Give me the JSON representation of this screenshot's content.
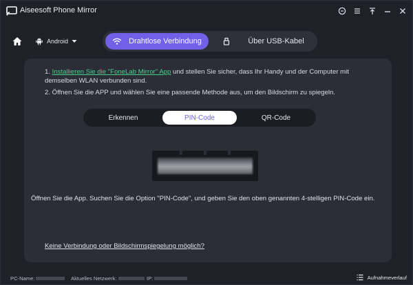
{
  "app": {
    "title": "Aiseesoft Phone Mirror"
  },
  "window_controls": [
    "feedback-icon",
    "menu-icon",
    "pin-icon",
    "minimize-icon",
    "close-icon"
  ],
  "nav": {
    "device_label": "Android",
    "modes": [
      {
        "label": "Drahtlose Verbindung",
        "active": true,
        "icon": "wifi-icon"
      },
      {
        "label": "Über USB-Kabel",
        "active": false,
        "icon": "usb-icon"
      }
    ]
  },
  "steps": {
    "step1_prefix": "1. ",
    "step1_link": "Installieren Sie die \"FoneLab Mirror\" App",
    "step1_rest": " und stellen Sie sicher, dass Ihr Handy und der Computer mit demselben WLAN verbunden sind.",
    "step2": "2. Öffnen Sie die APP und wählen Sie eine passende Methode aus, um den Bildschirm zu spiegeln."
  },
  "methods": [
    {
      "label": "Erkennen",
      "active": false
    },
    {
      "label": "PIN-Code",
      "active": true
    },
    {
      "label": "QR-Code",
      "active": false
    }
  ],
  "pin_instruction": "Öffnen Sie die App. Suchen Sie die Option \"PIN-Code\", und geben Sie den oben genannten 4-stelligen PIN-Code ein.",
  "help_link": "Keine Verbindung oder Bildschirmspiegelung möglich?",
  "status": {
    "pc_name_label": "PC-Name:",
    "network_label": "Aktuelles Netzwerk:",
    "ip_label": "IP:",
    "history_label": "Aufnahmeverlauf"
  },
  "colors": {
    "accent": "#6f62e9",
    "link_green": "#45d38a",
    "panel": "#2b2e37",
    "background": "#1f2128"
  }
}
